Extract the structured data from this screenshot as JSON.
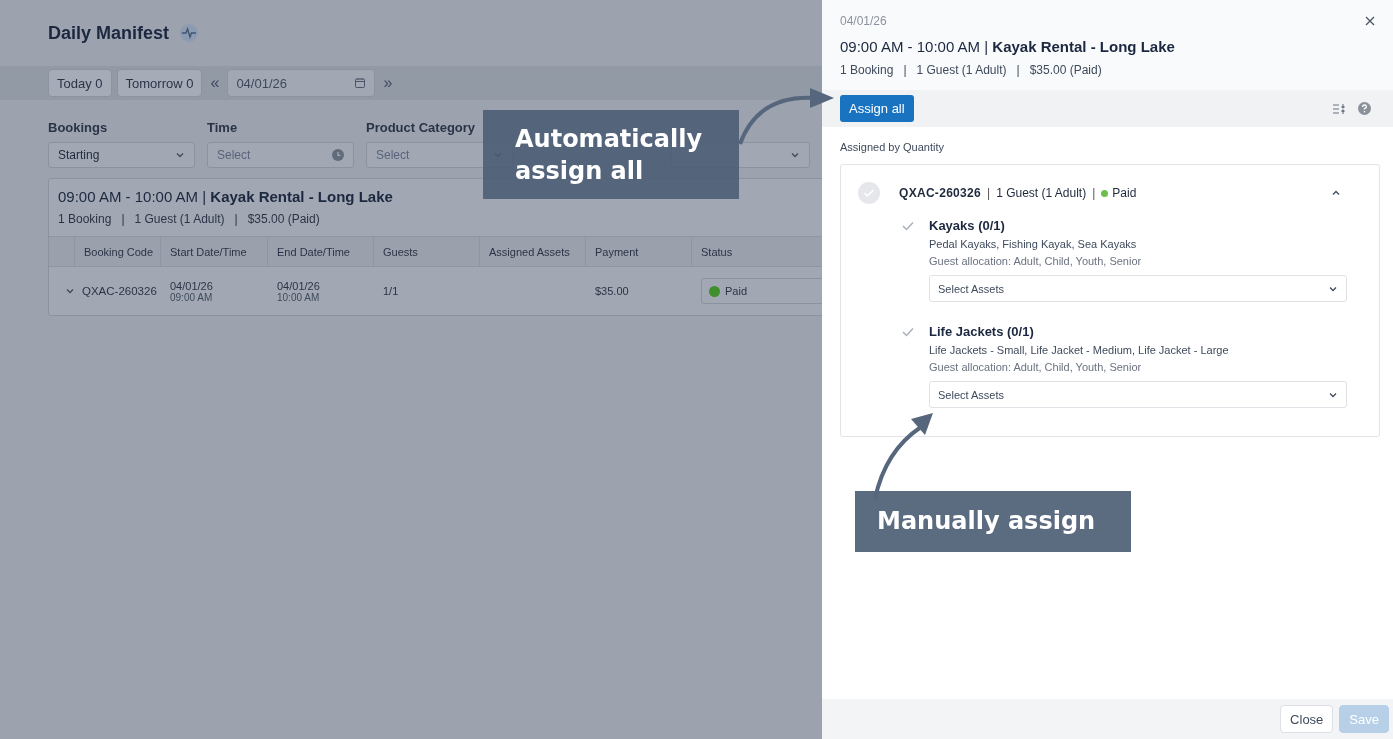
{
  "page": {
    "title": "Daily Manifest"
  },
  "date_bar": {
    "quick": [
      {
        "label": "Today 0"
      },
      {
        "label": "Tomorrow 0"
      }
    ],
    "prev": "«",
    "date": "04/01/26",
    "next": "»"
  },
  "filters": [
    {
      "label": "Bookings",
      "value": "Starting",
      "kind": "dropdown"
    },
    {
      "label": "Time",
      "placeholder": "Select",
      "kind": "time"
    },
    {
      "label": "Product Category",
      "placeholder": "Select",
      "kind": "dropdown"
    },
    {
      "kind": "dropdown"
    }
  ],
  "group": {
    "time": "09:00 AM - 10:00 AM |",
    "product": "Kayak Rental - Long Lake",
    "summary": "1 Booking   |   1 Guest (1 Adult)   |   $35.00 (Paid)"
  },
  "table": {
    "columns": [
      "Booking Code",
      "Start Date/Time",
      "End Date/Time",
      "Guests",
      "Assigned Assets",
      "Payment",
      "Status"
    ],
    "rows": [
      {
        "expanded": false,
        "booking_code": "QXAC-260326",
        "start_date": "04/01/26",
        "start_time": "09:00 AM",
        "end_date": "04/01/26",
        "end_time": "10:00 AM",
        "guests": "1/1",
        "payment": "$35.00",
        "status": {
          "label": "Paid",
          "color": "#3f8f2c"
        }
      }
    ]
  },
  "panel": {
    "date": "04/01/26",
    "time": "09:00 AM - 10:00 AM |",
    "product": "Kayak Rental - Long Lake",
    "summary": "1 Booking   |   1 Guest (1 Adult)   |   $35.00 (Paid)",
    "assign_all": "Assign all",
    "section_label": "Assigned by Quantity",
    "booking": {
      "code": "QXAC-260326",
      "separator": "|",
      "guests": "1 Guest (1 Adult)",
      "status": {
        "label": "Paid",
        "color": "#6cc04a"
      },
      "expanded": true,
      "complete": false,
      "items": [
        {
          "name": "Kayaks (0/1)",
          "assets": "Pedal Kayaks, Fishing Kayak, Sea Kayaks",
          "allocation": "Guest allocation: Adult, Child, Youth, Senior",
          "placeholder": "Select Assets",
          "done": false
        },
        {
          "name": "Life Jackets (0/1)",
          "assets": "Life Jackets - Small, Life Jacket - Medium, Life Jacket - Large",
          "allocation": "Guest allocation: Adult, Child, Youth, Senior",
          "placeholder": "Select Assets",
          "done": false
        }
      ]
    },
    "buttons": [
      {
        "label": "Close",
        "disabled": false
      },
      {
        "label": "Save",
        "disabled": true
      }
    ]
  },
  "callouts": [
    {
      "text": "Automatically assign all"
    },
    {
      "text": "Manually assign"
    }
  ]
}
